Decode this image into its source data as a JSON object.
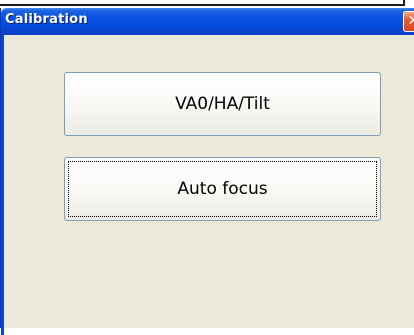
{
  "window": {
    "title": "Calibration",
    "close_glyph": "✕"
  },
  "buttons": {
    "va0_label": "VA0/HA/Tilt",
    "autofocus_label": "Auto focus"
  },
  "icons": {
    "close": "close-icon"
  },
  "colors": {
    "titlebar": "#0a53e4",
    "window_bg": "#ece9d8",
    "close_button": "#e55f35",
    "button_border": "#7f9db9"
  }
}
